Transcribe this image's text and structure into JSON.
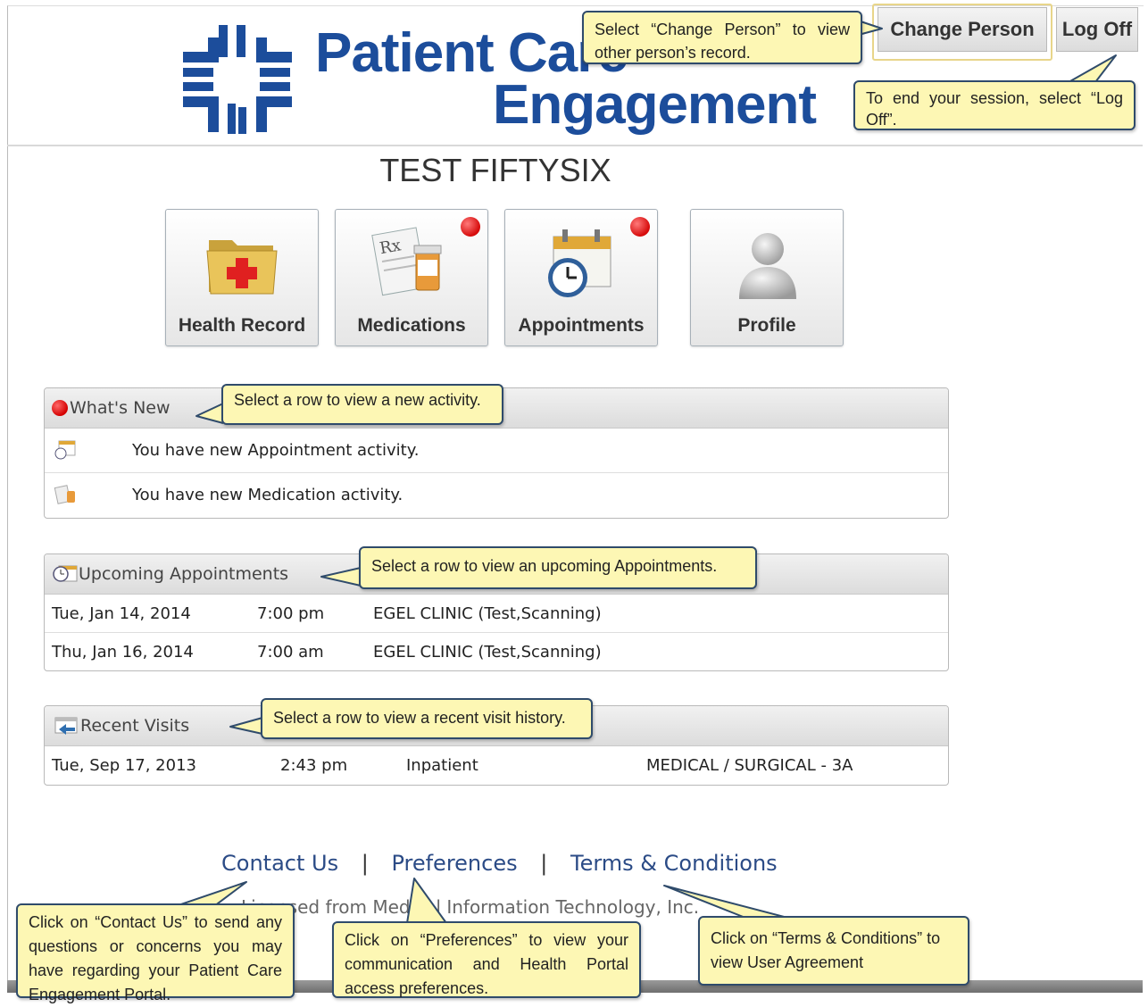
{
  "logo": {
    "line1": "Patient Care",
    "line2": "Engagement"
  },
  "header": {
    "change_person": "Change Person",
    "log_off": "Log Off"
  },
  "patient_name": "TEST FIFTYSIX",
  "tiles": [
    {
      "label": "Health Record",
      "icon": "folder-medical-icon",
      "badge": false
    },
    {
      "label": "Medications",
      "icon": "rx-prescription-icon",
      "badge": true
    },
    {
      "label": "Appointments",
      "icon": "calendar-clock-icon",
      "badge": true
    },
    {
      "label": "Profile",
      "icon": "user-silhouette-icon",
      "badge": false
    }
  ],
  "whats_new": {
    "title": "What's New",
    "rows": [
      {
        "icon": "calendar-clock-icon",
        "text": "You have new Appointment activity."
      },
      {
        "icon": "medication-icon",
        "text": "You have new Medication activity."
      }
    ]
  },
  "upcoming": {
    "title": "Upcoming Appointments",
    "rows": [
      {
        "date": "Tue, Jan 14, 2014",
        "time": "7:00 pm",
        "location": "EGEL CLINIC (Test,Scanning)"
      },
      {
        "date": "Thu, Jan 16, 2014",
        "time": "7:00 am",
        "location": "EGEL CLINIC (Test,Scanning)"
      }
    ]
  },
  "recent": {
    "title": "Recent Visits",
    "rows": [
      {
        "date": "Tue, Sep 17, 2013",
        "time": "2:43 pm",
        "type": "Inpatient",
        "unit": "MEDICAL / SURGICAL - 3A"
      }
    ]
  },
  "footer": {
    "contact": "Contact Us",
    "preferences": "Preferences",
    "terms": "Terms & Conditions",
    "separator": "|",
    "license": "Licensed from Medical Information Technology, Inc."
  },
  "callouts": {
    "change_person": "Select “Change Person” to view other person’s record.",
    "log_off": "To end your session, select “Log Off”.",
    "whats_new": "Select a row to view a new activity.",
    "upcoming": "Select a row to view an upcoming Appointments.",
    "recent": "Select a row to view a recent visit history.",
    "contact": "Click on “Contact Us” to send any questions or concerns you may have regarding your Patient Care Engagement Portal.",
    "preferences": "Click on “Preferences” to view your communication and Health Portal access preferences.",
    "terms": "Click on “Terms & Conditions” to view User Agreement"
  },
  "colors": {
    "brand": "#1c4d9b",
    "callout_bg": "#fdf7b4",
    "callout_border": "#2f4b6b",
    "badge": "#d60a0a"
  }
}
